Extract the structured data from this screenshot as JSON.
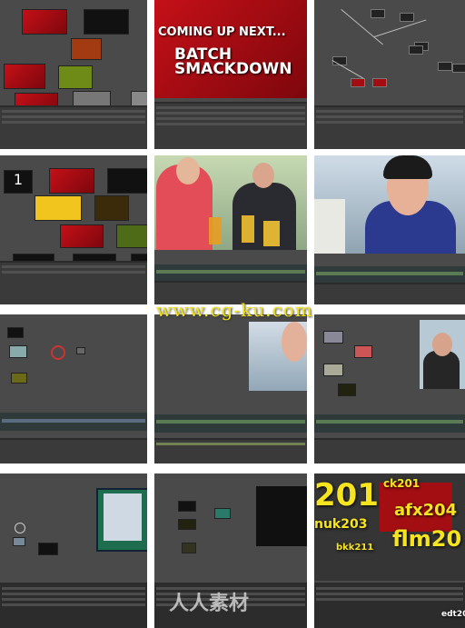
{
  "title_card": {
    "line1": "COMING UP NEXT...",
    "line2": "BATCH",
    "line3": "SMACKDOWN"
  },
  "batch_row": {
    "coming": "COMING UP NEXT...",
    "batch": "BATCH",
    "smack": "SMA"
  },
  "watermark_top": "www.cg-ku.com",
  "watermark_bottom": "人人素材",
  "overlay_labels": {
    "a": "201",
    "b": "ck201",
    "c": "afx204",
    "d": "nuk203",
    "e": "flm20",
    "f": "bkk211",
    "g": "edt20"
  },
  "colors": {
    "accent_red": "#c51018",
    "track_green": "#5b7b55",
    "label_yellow": "#f6e51e"
  }
}
